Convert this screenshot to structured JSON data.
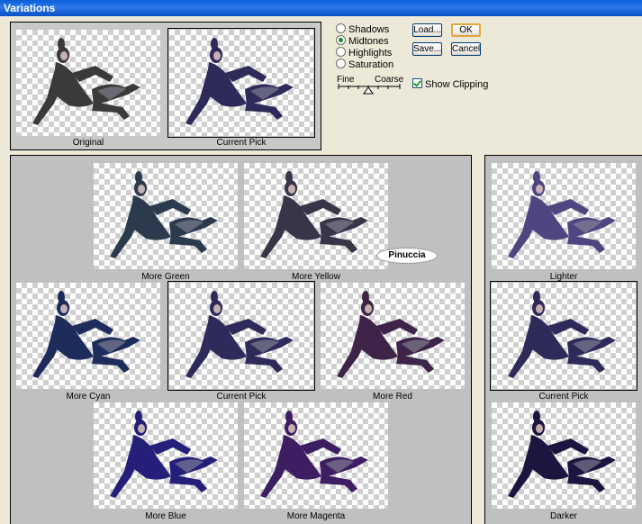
{
  "window": {
    "title": "Variations"
  },
  "tone": {
    "options": [
      "Shadows",
      "Midtones",
      "Highlights",
      "Saturation"
    ],
    "selected": "Midtones"
  },
  "slider": {
    "fine_label": "Fine",
    "coarse_label": "Coarse"
  },
  "buttons": {
    "load": "Load...",
    "save": "Save...",
    "ok": "OK",
    "cancel": "Cancel"
  },
  "show_clipping": {
    "label": "Show Clipping",
    "checked": true
  },
  "compare": {
    "original": "Original",
    "current": "Current Pick"
  },
  "color_grid": {
    "more_green": "More Green",
    "more_yellow": "More Yellow",
    "more_cyan": "More Cyan",
    "current": "Current Pick",
    "more_red": "More Red",
    "more_blue": "More Blue",
    "more_magenta": "More Magenta"
  },
  "brightness": {
    "lighter": "Lighter",
    "current": "Current Pick",
    "darker": "Darker"
  },
  "watermark": "Pinuccia",
  "colors": {
    "original": "#3a3a3a",
    "current": "#2e2a5a",
    "more_green": "#2c3a4e",
    "more_yellow": "#3a3448",
    "more_cyan": "#1e2c5c",
    "more_red": "#3e2448",
    "more_blue": "#24207a",
    "more_magenta": "#3e1e62",
    "lighter": "#4e4680",
    "darker": "#1a1640"
  }
}
